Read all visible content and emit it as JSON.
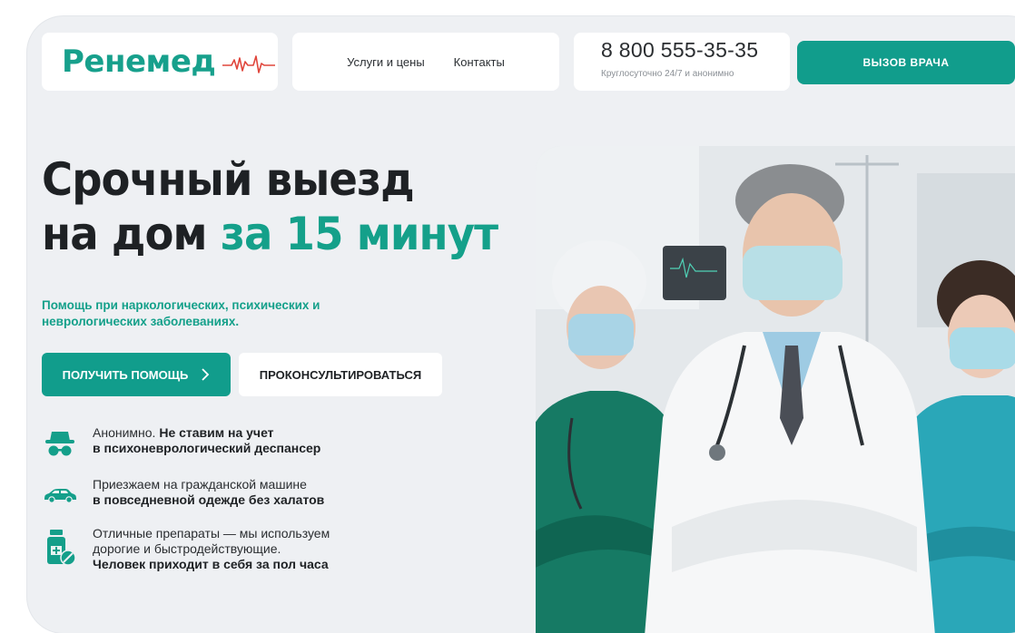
{
  "header": {
    "logo_text": "Ренемед",
    "nav": [
      {
        "label": "Услуги и цены"
      },
      {
        "label": "Контакты"
      }
    ],
    "phone": "8 800 555-35-35",
    "phone_note": "Круглосуточно 24/7 и анонимно",
    "call_button": "ВЫЗОВ ВРАЧА"
  },
  "hero": {
    "title_line1": "Срочный выезд",
    "title_line2_plain": "на дом ",
    "title_line2_accent": "за 15 минут",
    "subtitle": "Помощь при наркологических, психических и неврологических заболеваниях.",
    "primary_button": "ПОЛУЧИТЬ ПОМОЩЬ",
    "primary_button_icon": "chevron-right-icon",
    "secondary_button": "ПРОКОНСУЛЬТИРОВАТЬСЯ"
  },
  "features": [
    {
      "icon": "incognito-icon",
      "text_plain": "Анонимно. ",
      "text_bold": "Не ставим на учет",
      "text_bold2": "в психоневрологический деспансер"
    },
    {
      "icon": "car-icon",
      "text_plain": "Приезжаем на гражданской машине",
      "text_bold": "в повседневной одежде без халатов"
    },
    {
      "icon": "pills-icon",
      "text_plain": "Отличные препараты — мы используем",
      "text_plain2": "дорогие и быстродействующие.",
      "text_bold": "Человек приходит в себя за пол часа"
    }
  ],
  "colors": {
    "accent": "#14a08a",
    "button": "#119d8c",
    "background": "#eef0f3",
    "pulse": "#e0463c"
  }
}
